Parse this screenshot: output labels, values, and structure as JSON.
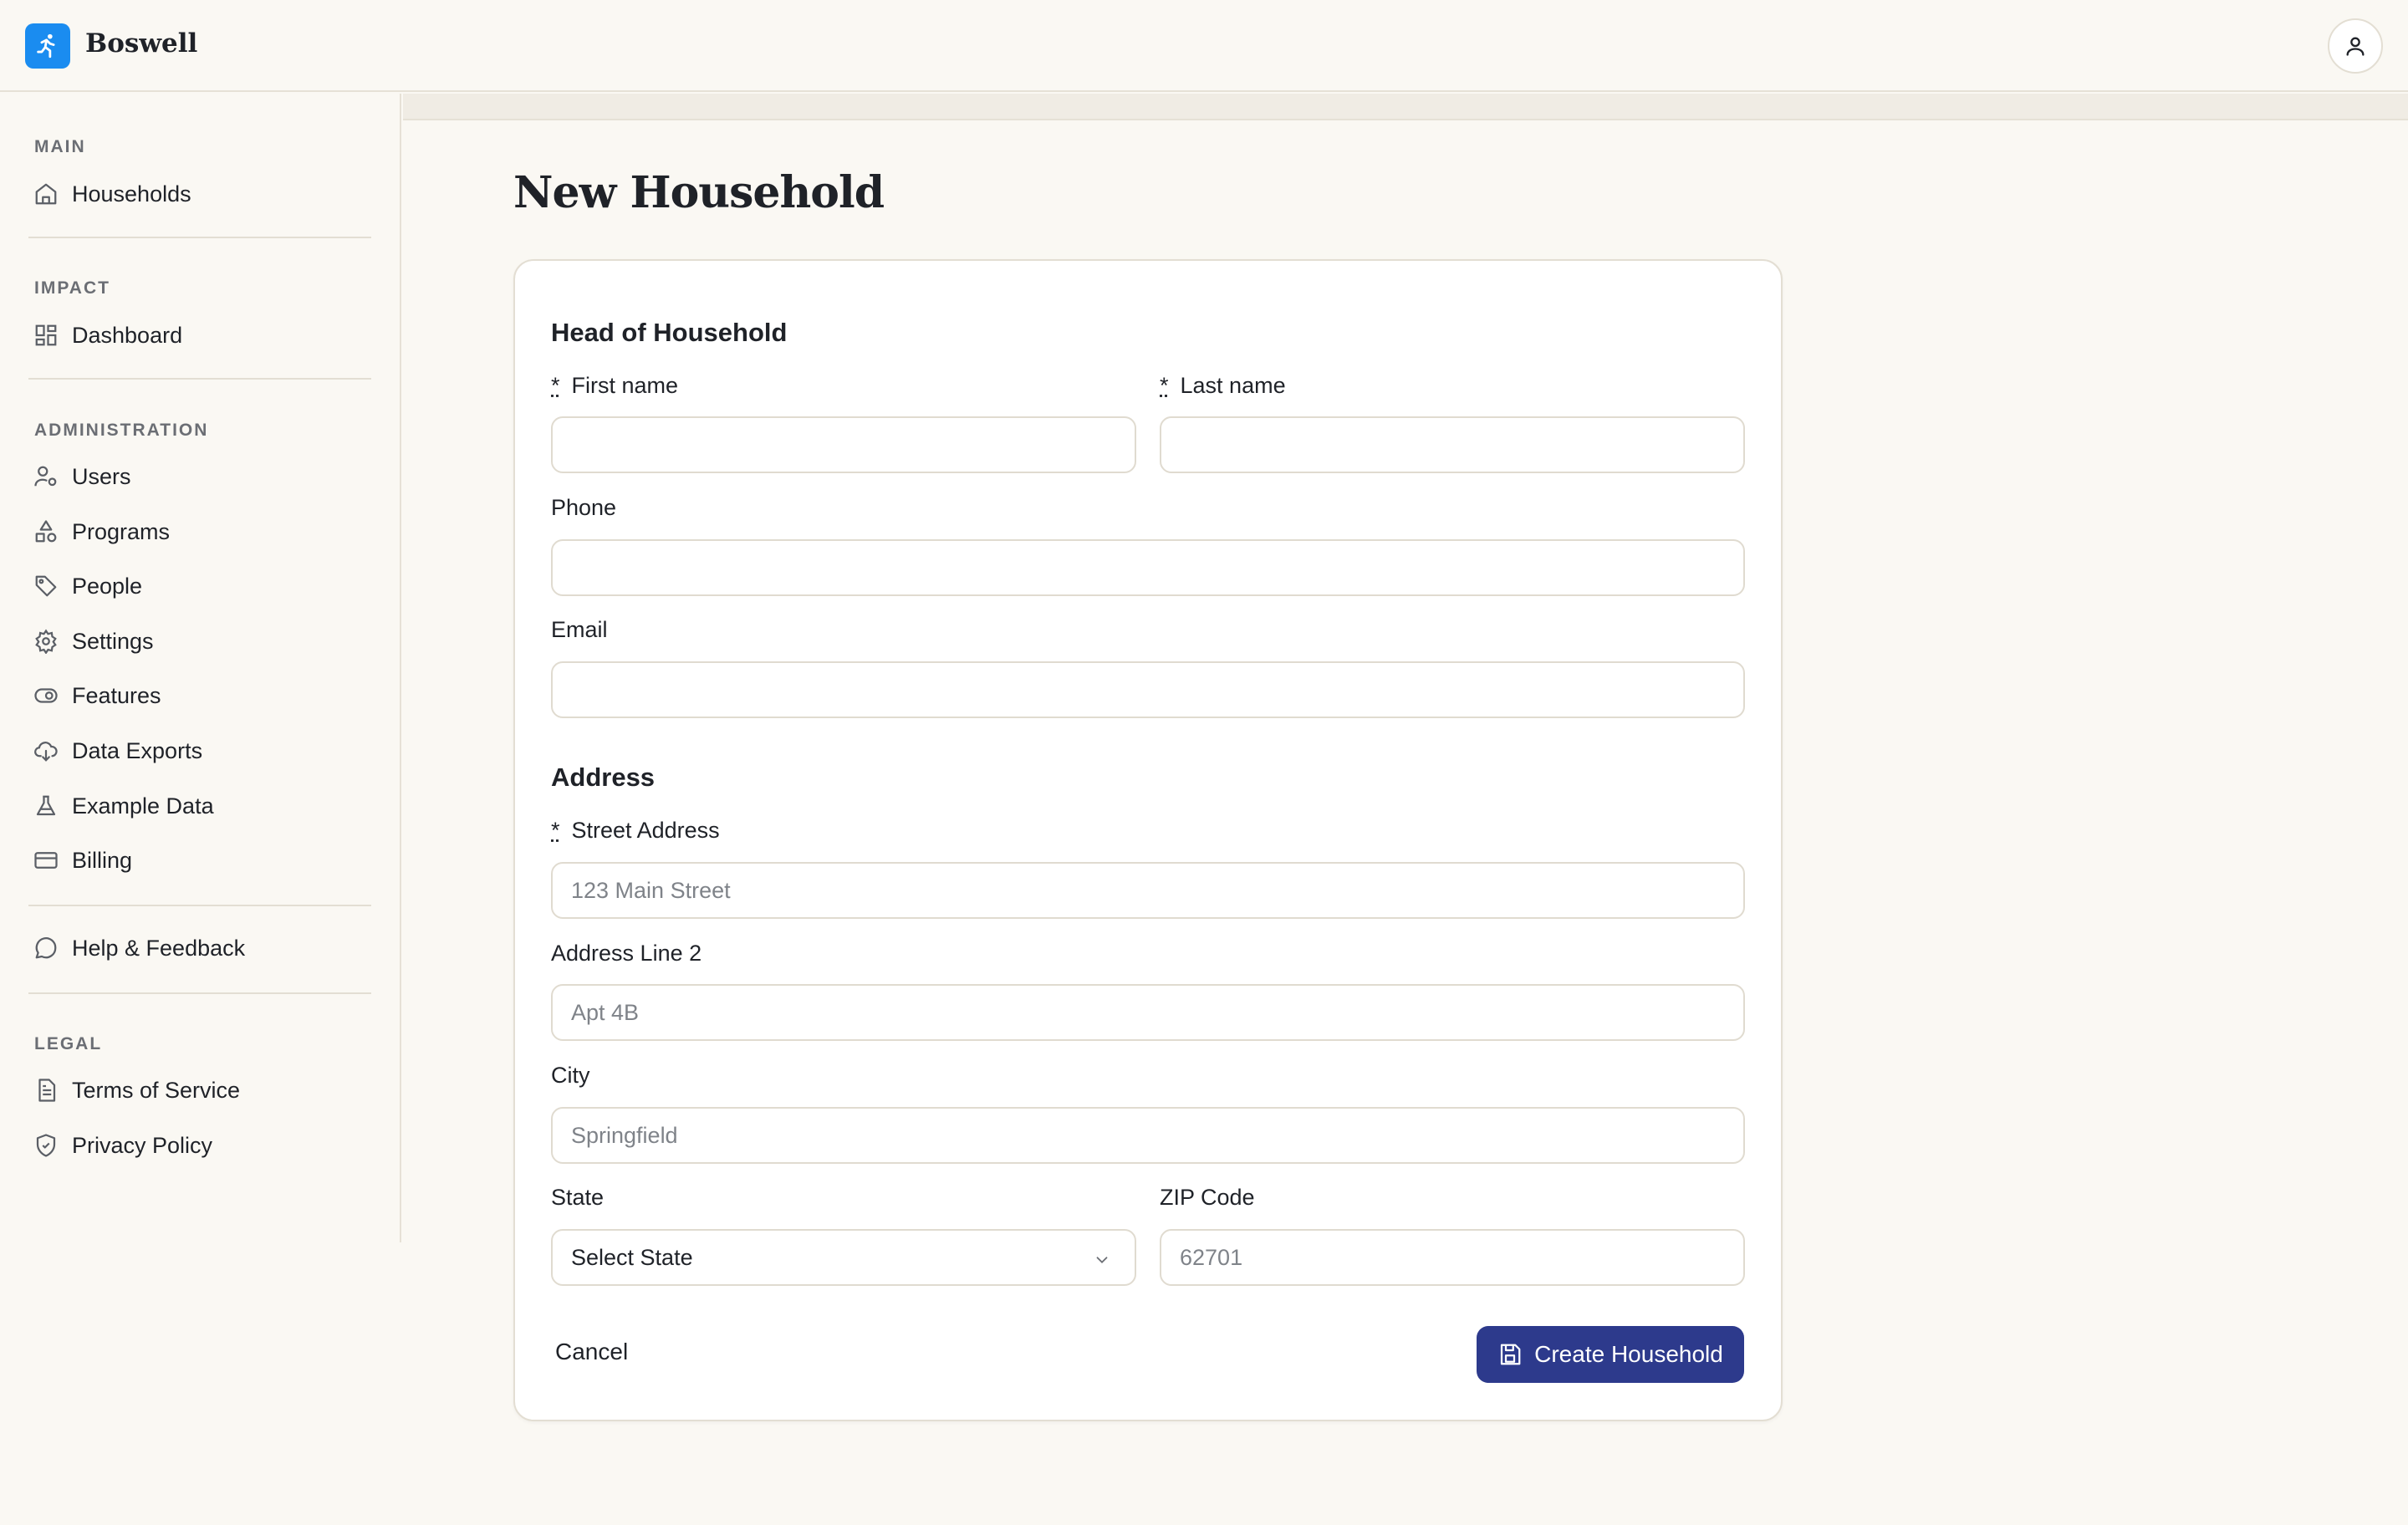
{
  "app": {
    "name": "Boswell",
    "logo_icon": "running-figure-icon",
    "brand_color": "#1a8cf0"
  },
  "header": {
    "account_icon": "user-icon"
  },
  "sidebar": {
    "sections": [
      {
        "title": "MAIN",
        "items": [
          {
            "label": "Households",
            "icon": "home-icon"
          }
        ]
      },
      {
        "title": "IMPACT",
        "items": [
          {
            "label": "Dashboard",
            "icon": "dashboard-icon"
          }
        ]
      },
      {
        "title": "ADMINISTRATION",
        "items": [
          {
            "label": "Users",
            "icon": "user-gear-icon"
          },
          {
            "label": "Programs",
            "icon": "shapes-icon"
          },
          {
            "label": "People",
            "icon": "tag-icon"
          },
          {
            "label": "Settings",
            "icon": "gear-icon"
          },
          {
            "label": "Features",
            "icon": "toggle-icon"
          },
          {
            "label": "Data Exports",
            "icon": "cloud-download-icon"
          },
          {
            "label": "Example Data",
            "icon": "flask-icon"
          },
          {
            "label": "Billing",
            "icon": "credit-card-icon"
          }
        ]
      },
      {
        "title": "",
        "items": [
          {
            "label": "Help & Feedback",
            "icon": "chat-bubble-icon"
          }
        ]
      },
      {
        "title": "LEGAL",
        "items": [
          {
            "label": "Terms of Service",
            "icon": "document-icon"
          },
          {
            "label": "Privacy Policy",
            "icon": "shield-check-icon"
          }
        ]
      }
    ]
  },
  "page": {
    "title": "New Household"
  },
  "form": {
    "head_section": "Head of Household",
    "first_name": {
      "label": "First name",
      "value": "",
      "placeholder": "",
      "required": "*"
    },
    "last_name": {
      "label": "Last name",
      "value": "",
      "placeholder": "",
      "required": "*"
    },
    "phone": {
      "label": "Phone",
      "value": "",
      "placeholder": ""
    },
    "email": {
      "label": "Email",
      "value": "",
      "placeholder": ""
    },
    "address_section": "Address",
    "street": {
      "label": "Street Address",
      "placeholder": "123 Main Street",
      "required": "*"
    },
    "address2": {
      "label": "Address Line 2",
      "placeholder": "Apt 4B"
    },
    "city": {
      "label": "City",
      "placeholder": "Springfield"
    },
    "state": {
      "label": "State",
      "selected": "Select State"
    },
    "zip": {
      "label": "ZIP Code",
      "placeholder": "62701"
    },
    "cancel_label": "Cancel",
    "submit_label": "Create Household",
    "submit_color": "#2d3a8c"
  }
}
